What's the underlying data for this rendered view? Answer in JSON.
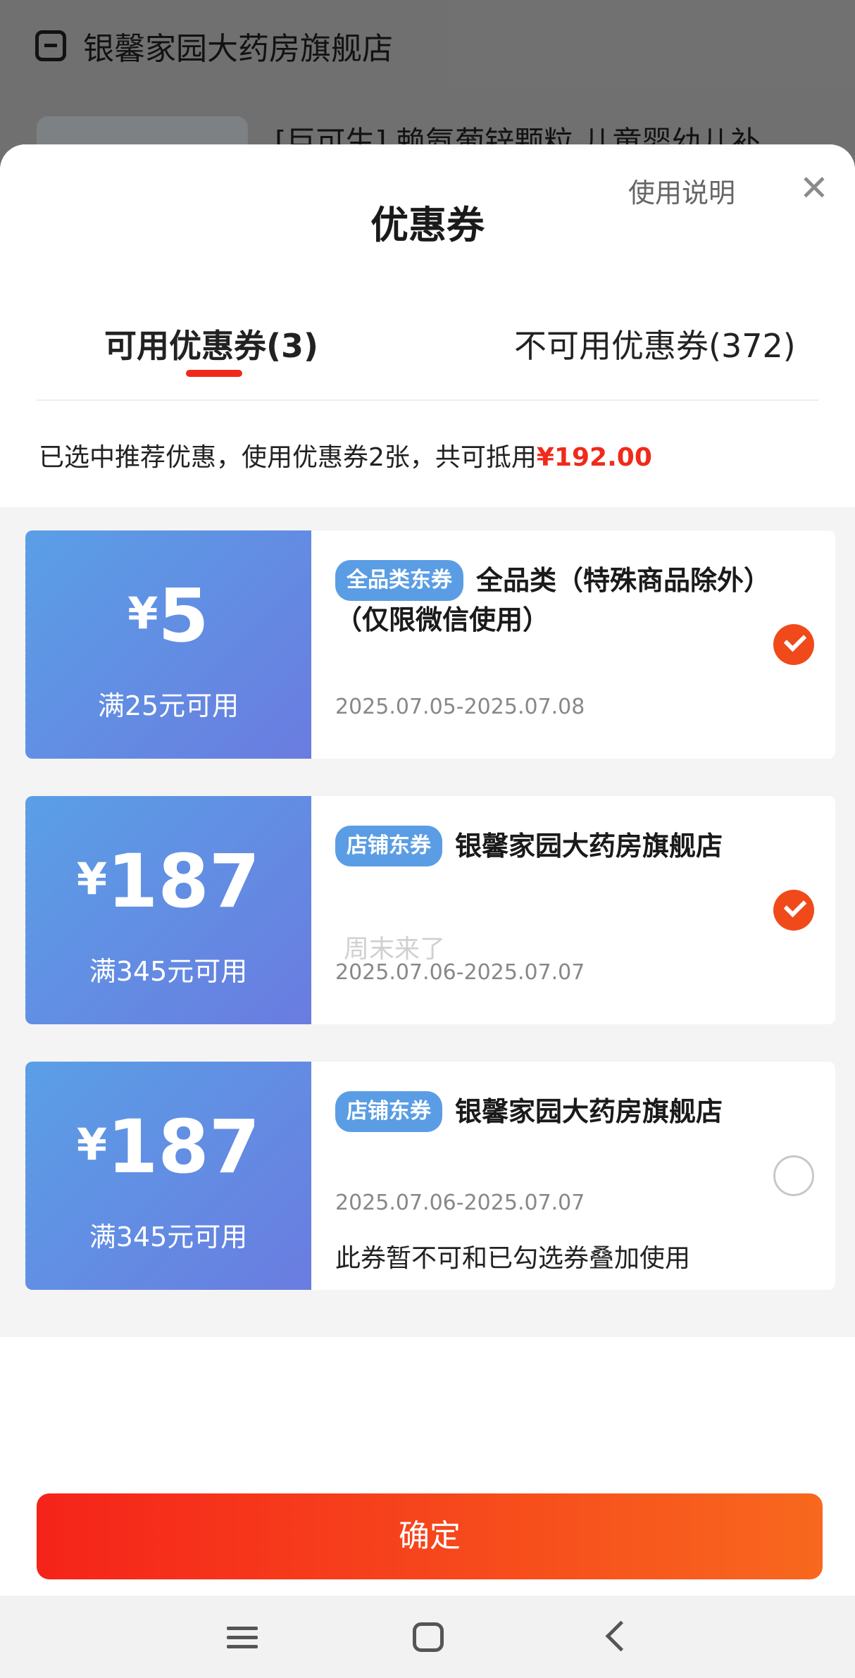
{
  "background": {
    "store_name": "银馨家园大药房旗舰店",
    "product_title": "[巨可生] 赖氨葡锌颗粒 儿童婴幼儿补"
  },
  "sheet": {
    "title": "优惠券",
    "help_link": "使用说明",
    "close_icon": "close-icon"
  },
  "tabs": [
    {
      "label": "可用优惠券(3)",
      "active": true
    },
    {
      "label": "不可用优惠券(372)",
      "active": false
    }
  ],
  "summary": {
    "text": "已选中推荐优惠，使用优惠券2张，共可抵用",
    "amount": "¥192.00"
  },
  "coupons": [
    {
      "yen": "¥",
      "amount": "5",
      "condition": "满25元可用",
      "tag": "全品类东券",
      "title": "全品类（特殊商品除外）（仅限微信使用）",
      "date": "2025.07.05-2025.07.08",
      "note": "",
      "selected": true
    },
    {
      "yen": "¥",
      "amount": "187",
      "condition": "满345元可用",
      "tag": "店铺东券",
      "title": "银馨家园大药房旗舰店",
      "date": "2025.07.06-2025.07.07",
      "note": "",
      "selected": true
    },
    {
      "yen": "¥",
      "amount": "187",
      "condition": "满345元可用",
      "tag": "店铺东券",
      "title": "银馨家园大药房旗舰店",
      "date": "2025.07.06-2025.07.07",
      "note": "此券暂不可和已勾选券叠加使用",
      "selected": false
    }
  ],
  "watermark": "周末来了",
  "confirm_label": "确定",
  "colors": {
    "accent_red": "#f02a1a",
    "coupon_blue": "#5a9fe6",
    "tag_blue": "#5b9de4"
  }
}
